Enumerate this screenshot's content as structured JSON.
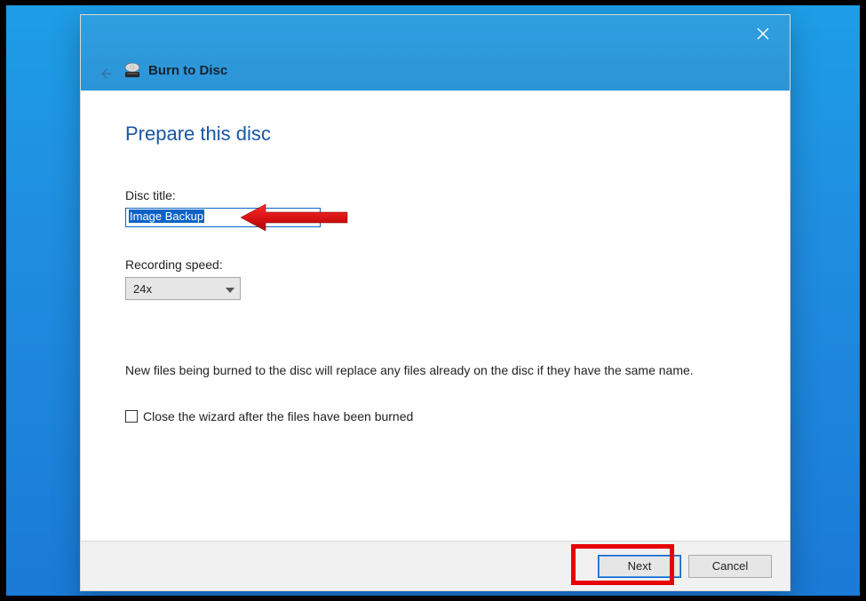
{
  "window": {
    "title": "Burn to Disc"
  },
  "page": {
    "heading": "Prepare this disc",
    "disc_title_label": "Disc title:",
    "disc_title_value": "Image Backup",
    "recording_speed_label": "Recording speed:",
    "recording_speed_value": "24x",
    "info_text": "New files being burned to the disc will replace any files already on the disc if they have the same name.",
    "close_checkbox_label": "Close the wizard after the files have been burned"
  },
  "footer": {
    "next_label": "Next",
    "cancel_label": "Cancel"
  }
}
